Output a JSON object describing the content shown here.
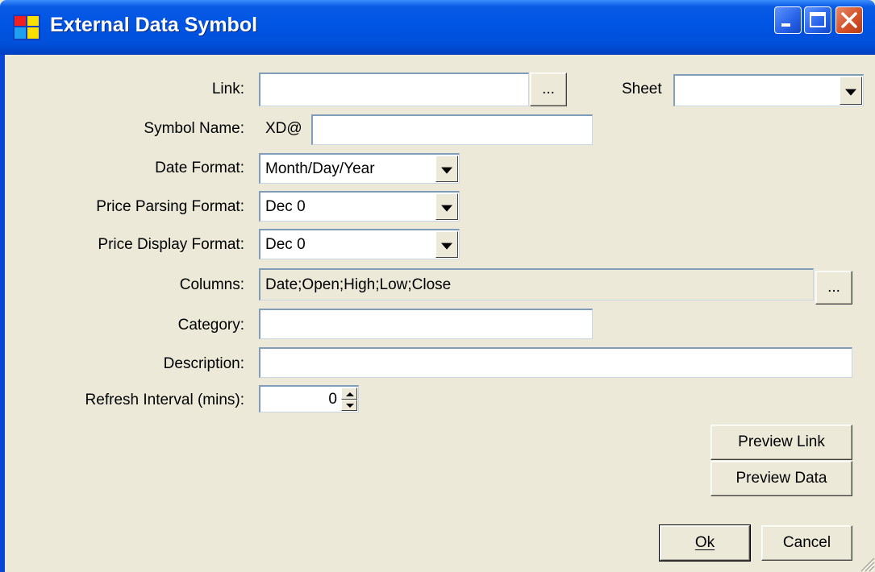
{
  "window": {
    "title": "External Data Symbol"
  },
  "form": {
    "link_label": "Link:",
    "link_value": "",
    "link_browse": "...",
    "sheet_label": "Sheet",
    "sheet_value": "",
    "symbol_name_label": "Symbol Name:",
    "symbol_prefix": "XD@",
    "symbol_name_value": "",
    "date_format_label": "Date Format:",
    "date_format_value": "Month/Day/Year",
    "price_parsing_label": "Price Parsing Format:",
    "price_parsing_value": "Dec 0",
    "price_display_label": "Price Display Format:",
    "price_display_value": "Dec 0",
    "columns_label": "Columns:",
    "columns_value": "Date;Open;High;Low;Close",
    "columns_browse": "...",
    "category_label": "Category:",
    "category_value": "",
    "description_label": "Description:",
    "description_value": "",
    "refresh_label": "Refresh Interval (mins):",
    "refresh_value": "0"
  },
  "buttons": {
    "preview_link": "Preview Link",
    "preview_data": "Preview Data",
    "ok": "Ok",
    "cancel": "Cancel"
  }
}
